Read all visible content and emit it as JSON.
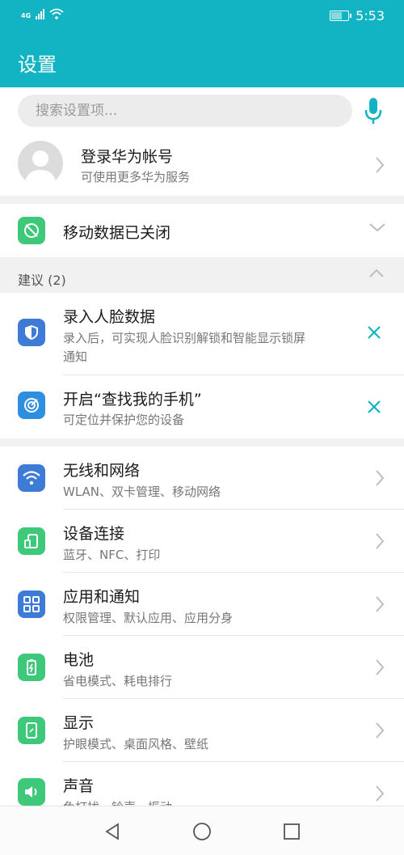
{
  "status_bar": {
    "network": "4G",
    "time": "5:53"
  },
  "header": {
    "title": "设置"
  },
  "search": {
    "placeholder": "搜索设置项..."
  },
  "account": {
    "title": "登录华为帐号",
    "subtitle": "可使用更多华为服务"
  },
  "mobile_data": {
    "label": "移动数据已关闭"
  },
  "suggestions": {
    "header": "建议 (2)",
    "items": [
      {
        "title": "录入人脸数据",
        "subtitle_line1": "录入后，可实现人脸识别解锁和智能显示锁屏",
        "subtitle_line2": "通知",
        "icon": "shield-icon"
      },
      {
        "title": "开启“查找我的手机”",
        "subtitle_line1": "可定位并保护您的设备",
        "icon": "radar-icon"
      }
    ]
  },
  "settings": [
    {
      "title": "无线和网络",
      "subtitle": "WLAN、双卡管理、移动网络",
      "icon": "wifi-icon"
    },
    {
      "title": "设备连接",
      "subtitle": "蓝牙、NFC、打印",
      "icon": "device-connect-icon"
    },
    {
      "title": "应用和通知",
      "subtitle": "权限管理、默认应用、应用分身",
      "icon": "apps-grid-icon"
    },
    {
      "title": "电池",
      "subtitle": "省电模式、耗电排行",
      "icon": "battery-icon"
    },
    {
      "title": "显示",
      "subtitle": "护眼模式、桌面风格、壁纸",
      "icon": "display-icon"
    },
    {
      "title": "声音",
      "subtitle": "免打扰、铃声、振动",
      "icon": "speaker-icon"
    }
  ],
  "colors": {
    "accent": "#12b3c2",
    "green": "#3ec87a",
    "blue": "#3d7bd6",
    "teal": "#1fa3b5"
  }
}
